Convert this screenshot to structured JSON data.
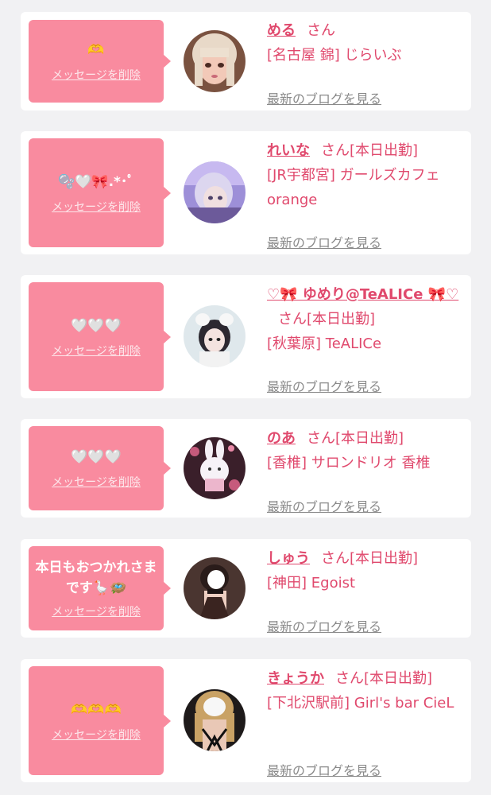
{
  "colors": {
    "background": "#f1f1f3",
    "card": "#ffffff",
    "bubble": "#f98b9f",
    "accent": "#e0496d",
    "link_gray": "#8a8a8a"
  },
  "messages": [
    {
      "message": "🫶",
      "delete_label": "メッセージを削除",
      "name": "める",
      "suffix": "さん",
      "status": "",
      "shop": "[名古屋 錦] じらいぶ",
      "blog_label": "最新のブログを見る",
      "avatar_icon": "girl-photo-avatar"
    },
    {
      "message": "🫧🤍🎀.*･ﾟ",
      "delete_label": "メッセージを削除",
      "name": "れいな",
      "suffix": "さん",
      "status": "[本日出勤]",
      "shop": "[JR宇都宮] ガールズカフェ orange",
      "blog_label": "最新のブログを見る",
      "avatar_icon": "girl-photo-avatar"
    },
    {
      "message": "🤍🤍🤍",
      "delete_label": "メッセージを削除",
      "name": "♡🎀 ゆめり@TeALICe 🎀♡",
      "suffix": "さん",
      "status": "[本日出勤]",
      "shop": "[秋葉原] TeALICe",
      "blog_label": "最新のブログを見る",
      "avatar_icon": "girl-photo-avatar"
    },
    {
      "message": "🤍🤍🤍",
      "delete_label": "メッセージを削除",
      "name": "のあ",
      "suffix": "さん",
      "status": "[本日出勤]",
      "shop": "[香椎] サロンドリオ 香椎",
      "blog_label": "最新のブログを見る",
      "avatar_icon": "plush-bunny-avatar"
    },
    {
      "message": "本日もおつかれさまです🪿🪺",
      "delete_label": "メッセージを削除",
      "name": "しゅう",
      "suffix": "さん",
      "status": "[本日出勤]",
      "shop": "[神田] Egoist",
      "blog_label": "最新のブログを見る",
      "avatar_icon": "girl-photo-avatar"
    },
    {
      "message": "🫶🫶🫶",
      "delete_label": "メッセージを削除",
      "name": "きょうか",
      "suffix": "さん",
      "status": "[本日出勤]",
      "shop": "[下北沢駅前] Girl's bar CieL",
      "blog_label": "最新のブログを見る",
      "avatar_icon": "girl-photo-avatar"
    }
  ]
}
